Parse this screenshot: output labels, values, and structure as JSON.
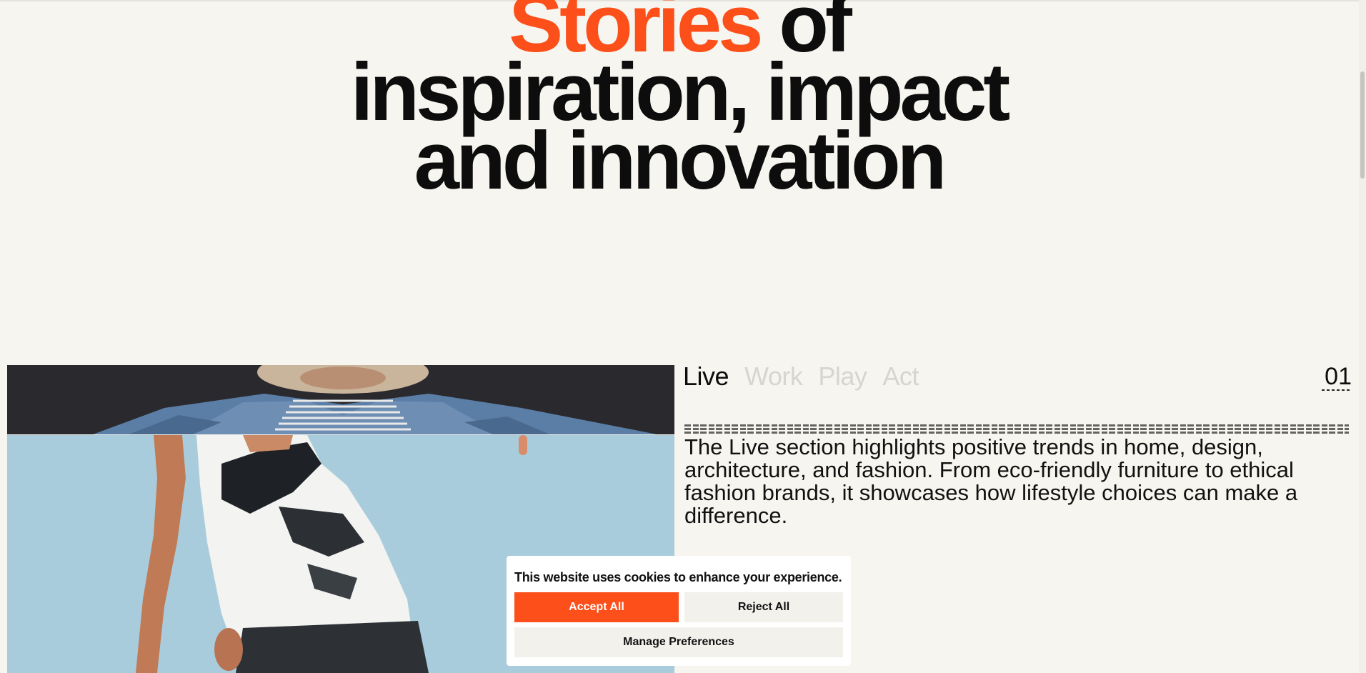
{
  "hero": {
    "accent_word": "Stories",
    "line1_rest": "of",
    "line2": "inspiration, impact",
    "line3": "and innovation"
  },
  "tabs": [
    {
      "label": "Live",
      "active": true
    },
    {
      "label": "Work",
      "active": false
    },
    {
      "label": "Play",
      "active": false
    },
    {
      "label": "Act",
      "active": false
    }
  ],
  "counter": "01",
  "description": "The Live section highlights positive trends in home, design, architecture, and fashion. From eco-friendly furniture to ethical fashion brands, it showcases how lifestyle choices can make a difference.",
  "cookie_banner": {
    "message": "This website uses cookies to enhance your experience.",
    "accept_label": "Accept All",
    "reject_label": "Reject All",
    "manage_label": "Manage Preferences"
  },
  "colors": {
    "accent": "#fc4f1a",
    "background": "#f7f5ef",
    "text": "#0d0d0d",
    "inactive_tab": "#d7d5d1"
  }
}
